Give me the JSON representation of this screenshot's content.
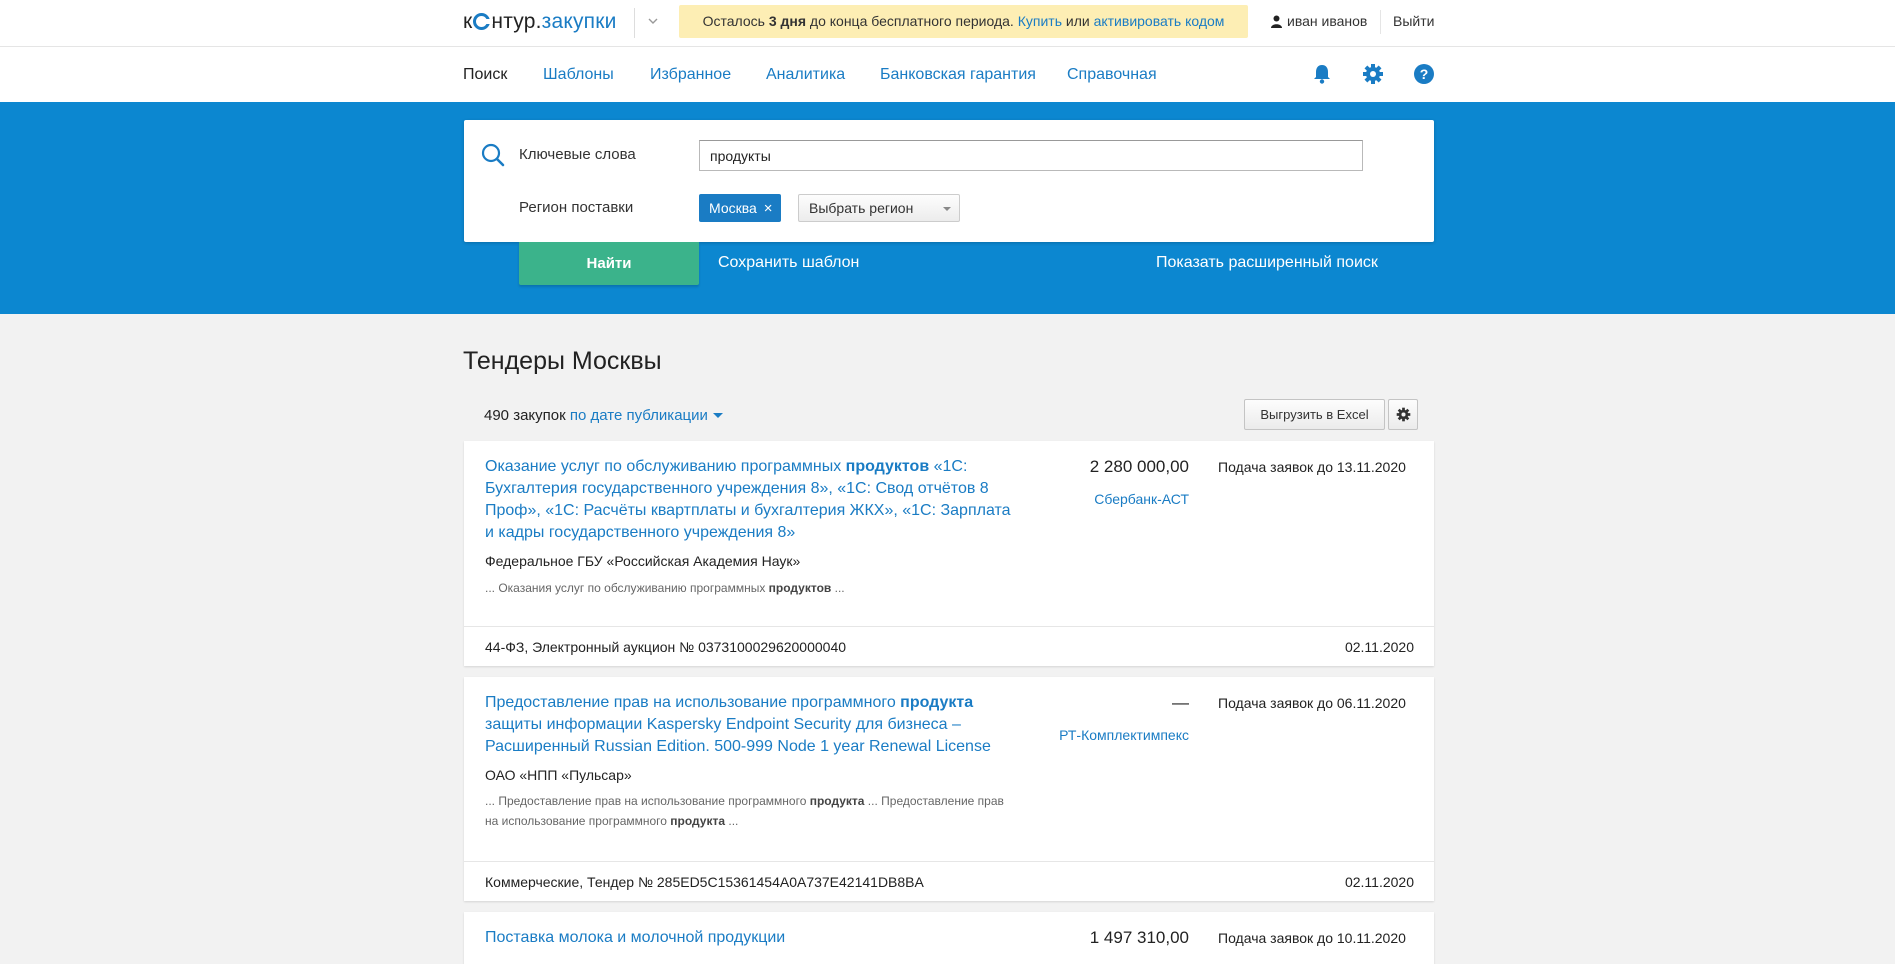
{
  "header": {
    "logo_part1": "к",
    "logo_part2": "нтур.",
    "logo_part3": "закупки",
    "trial_prefix": "Осталось ",
    "trial_days": "3 дня",
    "trial_middle": " до конца бесплатного периода. ",
    "trial_buy": "Купить",
    "trial_or": " или ",
    "trial_activate": "активировать кодом",
    "user_name": "иван иванов",
    "logout": "Выйти"
  },
  "nav": {
    "items": [
      {
        "label": "Поиск",
        "active": true
      },
      {
        "label": "Шаблоны"
      },
      {
        "label": "Избранное"
      },
      {
        "label": "Аналитика"
      },
      {
        "label": "Банковская гарантия"
      },
      {
        "label": "Справочная"
      }
    ],
    "icons": [
      "bell-icon",
      "gear-icon",
      "help-icon"
    ]
  },
  "search": {
    "keywords_label": "Ключевые слова",
    "keywords_value": "продукты",
    "region_label": "Регион поставки",
    "region_tag": "Москва",
    "region_select": "Выбрать регион",
    "find_button": "Найти",
    "save_template": "Сохранить шаблон",
    "advanced_search": "Показать расширенный поиск"
  },
  "results": {
    "title": "Тендеры Москвы",
    "count": "490 закупок",
    "sort_label": "по дате публикации",
    "excel_button": "Выгрузить в Excel",
    "tenders": [
      {
        "title_parts": [
          {
            "text": "Оказание услуг по обслуживанию программных "
          },
          {
            "text": "продуктов",
            "bold": true
          },
          {
            "text": " «1С: Бухгалтерия государственного учреждения 8», «1С: Свод отчётов 8 Проф», «1С: Расчёты квартплаты и бухгалтерия ЖКХ», «1С: Зарплата и кадры государственного учреждения 8»"
          }
        ],
        "price": "2 280 000,00",
        "platform": "Сбербанк-АСТ",
        "deadline": "Подача заявок до 13.11.2020",
        "customer": "Федеральное ГБУ «Российская Академия Наук»",
        "snippet_parts": [
          {
            "text": "... Оказания услуг по обслуживанию программных "
          },
          {
            "text": "продуктов",
            "bold": true
          },
          {
            "text": " ..."
          }
        ],
        "procedure": "44-ФЗ, Электронный аукцион № 0373100029620000040",
        "published": "02.11.2020"
      },
      {
        "title_parts": [
          {
            "text": "Предоставление прав на использование программного "
          },
          {
            "text": "продукта",
            "bold": true
          },
          {
            "text": " защиты информации Kaspersky Endpoint Security для бизнеса – Расширенный Russian Edition. 500-999 Node 1 year Renewal License"
          }
        ],
        "price": "—",
        "platform": "РТ-Комплектимпекс",
        "deadline": "Подача заявок до 06.11.2020",
        "customer": "ОАО «НПП «Пульсар»",
        "snippet_parts": [
          {
            "text": "... Предоставление прав на использование программного "
          },
          {
            "text": "продукта",
            "bold": true
          },
          {
            "text": " ... Предоставление прав на использование программного "
          },
          {
            "text": "продукта",
            "bold": true
          },
          {
            "text": " ..."
          }
        ],
        "procedure": "Коммерческие, Тендер № 285ED5C15361454A0A737E42141DB8BA",
        "published": "02.11.2020"
      },
      {
        "title_parts": [
          {
            "text": "Поставка молока и молочной продукции"
          }
        ],
        "price": "1 497 310,00",
        "deadline": "Подача заявок до 10.11.2020"
      }
    ]
  }
}
